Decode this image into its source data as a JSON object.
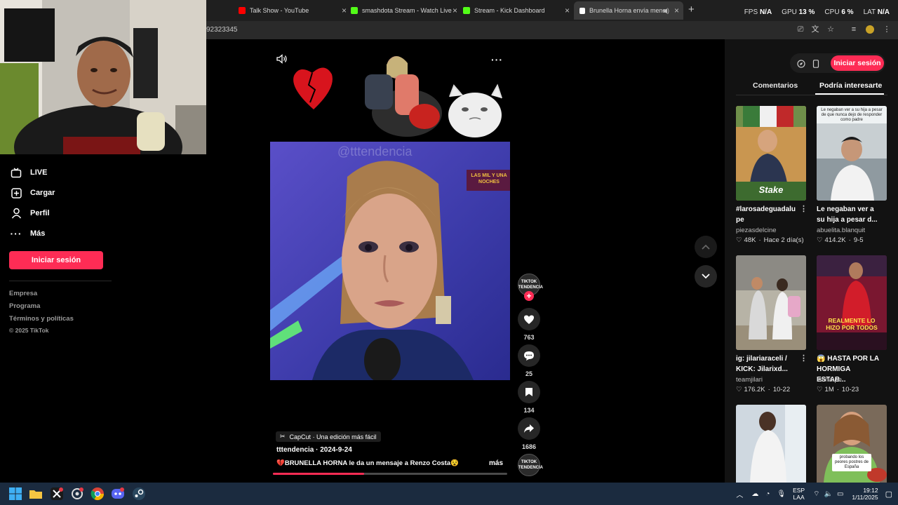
{
  "browser": {
    "tabs": [
      {
        "title": "Talk Show - YouTube",
        "color": "#ff0000"
      },
      {
        "title": "smashdota Stream - Watch Live",
        "color": "#53fc18"
      },
      {
        "title": "Stream - Kick Dashboard",
        "color": "#53fc18"
      },
      {
        "title": "Brunella Horna envía mens",
        "color": "#ffffff"
      }
    ],
    "url_fragment": "92323345",
    "stats": {
      "fps_label": "FPS",
      "fps_value": "N/A",
      "gpu_label": "GPU",
      "gpu_value": "13 %",
      "cpu_label": "CPU",
      "cpu_value": "6 %",
      "lat_label": "LAT",
      "lat_value": "N/A"
    }
  },
  "nav": {
    "items": [
      {
        "label": "LIVE",
        "icon": "live-icon"
      },
      {
        "label": "Cargar",
        "icon": "upload-icon"
      },
      {
        "label": "Perfil",
        "icon": "profile-icon"
      },
      {
        "label": "Más",
        "icon": "more-icon"
      }
    ],
    "login_label": "Iniciar sesión",
    "footer": [
      "Empresa",
      "Programa",
      "Términos y políticas"
    ],
    "copyright": "© 2025 TikTok"
  },
  "video": {
    "watermark": "@tttendencia",
    "show_logo": "LAS MIL Y UNA NOCHES",
    "likes": "763",
    "comments": "25",
    "saves": "134",
    "shares": "1686",
    "capcut": "CapCut · Una edición más fácil",
    "author_line": "tttendencia · 2024-9-24",
    "caption": "💔BRUNELLA HORNA le da un mensaje a Renzo Costa😵 ...",
    "more_label": "más",
    "progress_fraction": 0.39,
    "badge_text": "TIKTOK TENDENCIA"
  },
  "rpanel": {
    "login_label": "Iniciar sesión",
    "tabs": [
      "Comentarios",
      "Podría interesarte"
    ],
    "cards": [
      {
        "title": "#larosadeguadalu pe",
        "author": "piezasdelcine",
        "likes": "48K",
        "date": "Hace 2 día(s)",
        "overlay": "Stake"
      },
      {
        "title": "Le negaban ver a su hija a pesar d...",
        "author": "abuelita.blanquit",
        "likes": "414.2K",
        "date": "9-5",
        "overlay": "Le negaban ver a su hija a pesar de que nunca dejo de responder como padre"
      },
      {
        "title": "ig: jilariaraceli / KICK: Jilarixd...",
        "author": "teamjilari",
        "likes": "176.2K",
        "date": "10-22",
        "overlay": ""
      },
      {
        "title": "😱 HASTA POR LA HORMIGA ESTAB...",
        "author": "latina.pe",
        "likes": "1M",
        "date": "10-23",
        "overlay": "REALMENTE LO HIZO POR TODOS"
      },
      {
        "title": "",
        "author": "",
        "likes": "",
        "date": "",
        "overlay": ""
      },
      {
        "title": "",
        "author": "",
        "likes": "",
        "date": "",
        "overlay": "probando los peores postres de España"
      }
    ]
  },
  "taskbar": {
    "lang": "ESP",
    "lang2": "LAA",
    "time": "19:12",
    "date": "1/11/2025"
  },
  "colors": {
    "accent": "#fe2c55",
    "bg": "#000000",
    "panel": "#121212"
  }
}
